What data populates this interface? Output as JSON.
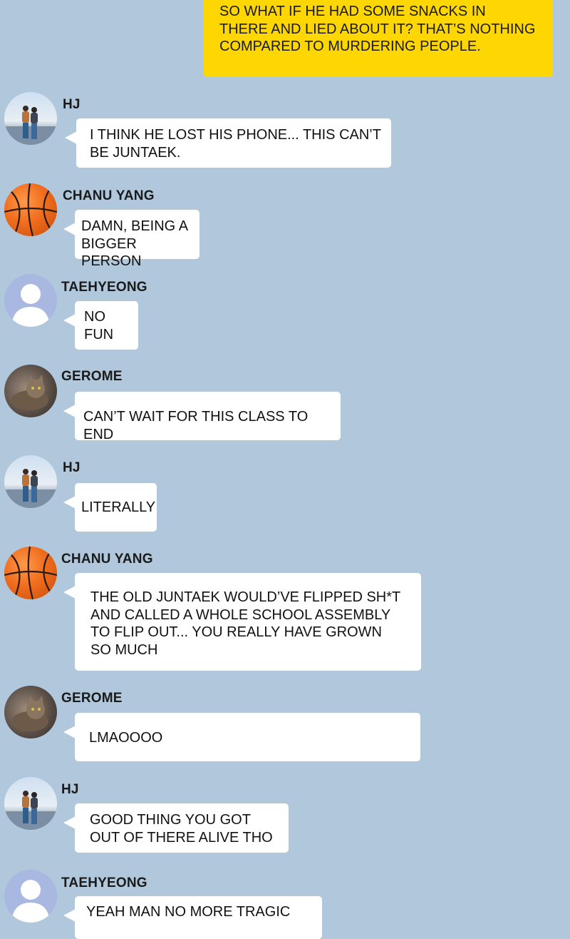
{
  "outgoing_message": "SO WHAT IF HE HAD SOME SNACKS IN\nTHERE AND LIED ABOUT IT? THAT’S NOTHING\nCOMPARED TO MURDERING PEOPLE.",
  "messages": [
    {
      "sender": "HJ",
      "avatar": "couple-photo-avatar",
      "text": "I THINK HE LOST HIS PHONE... THIS CAN’T\nBE JUNTAEK."
    },
    {
      "sender": "CHANU YANG",
      "avatar": "basketball-avatar",
      "text": "DAMN, BEING A\nBIGGER PERSON"
    },
    {
      "sender": "TAEHYEONG",
      "avatar": "default-user-avatar",
      "text": "NO\nFUN"
    },
    {
      "sender": "GEROME",
      "avatar": "cat-avatar",
      "text": "CAN’T WAIT FOR THIS CLASS TO END"
    },
    {
      "sender": "HJ",
      "avatar": "couple-photo-avatar",
      "text": "LITERALLY"
    },
    {
      "sender": "CHANU YANG",
      "avatar": "basketball-avatar",
      "text": "THE OLD JUNTAEK WOULD’VE FLIPPED SH*T\nAND CALLED A WHOLE SCHOOL ASSEMBLY\nTO FLIP OUT... YOU REALLY HAVE GROWN\nSO MUCH"
    },
    {
      "sender": "GEROME",
      "avatar": "cat-avatar",
      "text": "LMAOOOO"
    },
    {
      "sender": "HJ",
      "avatar": "couple-photo-avatar",
      "text": "GOOD THING YOU GOT\nOUT OF THERE ALIVE THO"
    },
    {
      "sender": "TAEHYEONG",
      "avatar": "default-user-avatar",
      "text": "YEAH MAN NO MORE TRAGIC"
    }
  ]
}
